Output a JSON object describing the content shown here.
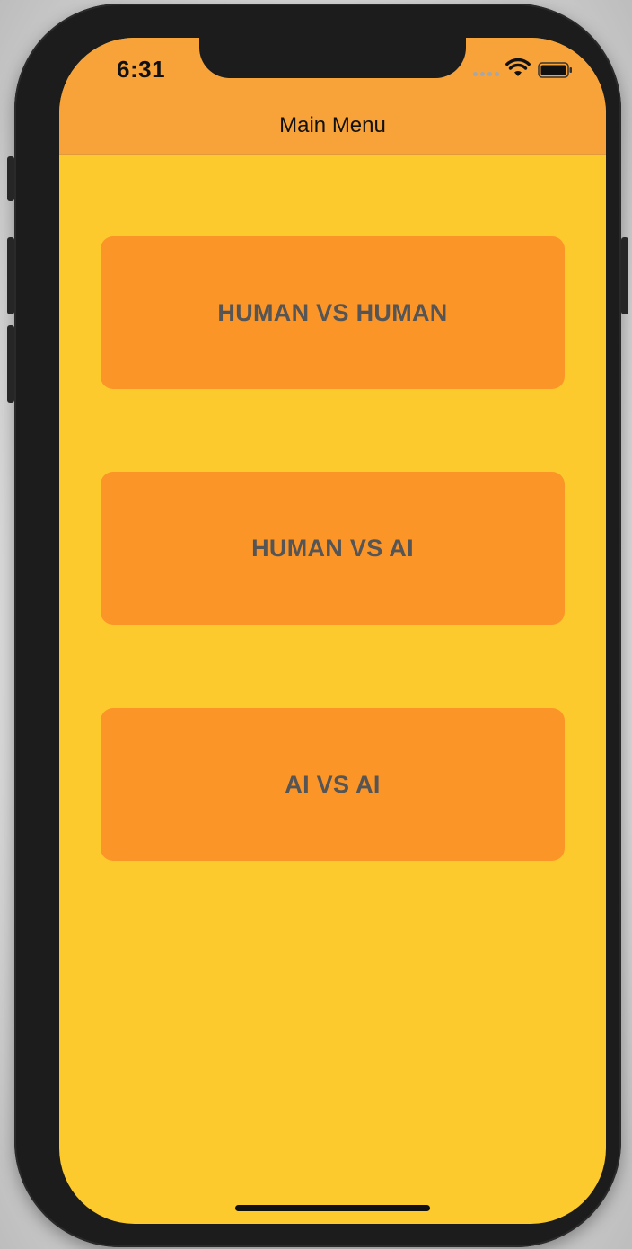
{
  "status_bar": {
    "time": "6:31"
  },
  "nav": {
    "title": "Main Menu"
  },
  "menu": {
    "buttons": [
      {
        "label": "HUMAN VS HUMAN"
      },
      {
        "label": "HUMAN VS AI"
      },
      {
        "label": "AI VS AI"
      }
    ]
  },
  "colors": {
    "background": "#fdca2e",
    "navbar": "#f8a23a",
    "button": "#fc9528",
    "button_text": "#555555"
  },
  "icons": {
    "signal": "signal-dots-icon",
    "wifi": "wifi-icon",
    "battery": "battery-icon"
  }
}
